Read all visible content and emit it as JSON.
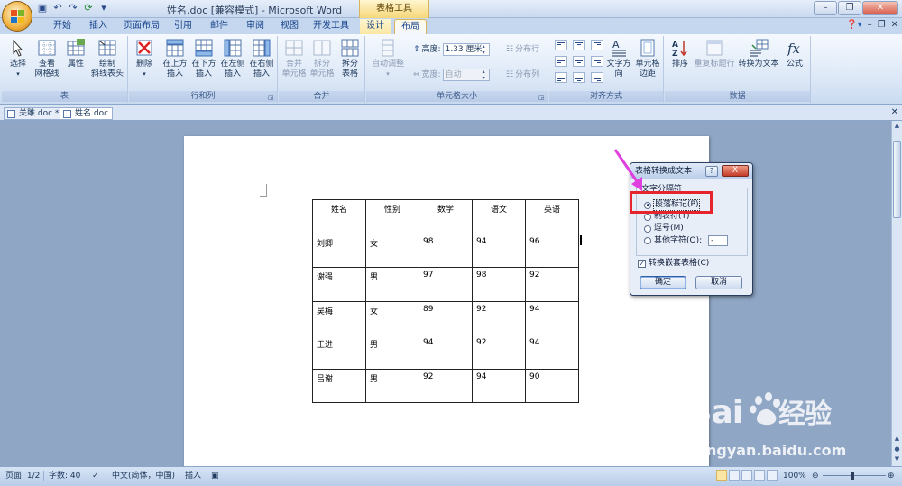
{
  "window": {
    "title": "姓名.doc [兼容模式] - Microsoft Word",
    "context_tab_group": "表格工具"
  },
  "tabs": [
    {
      "label": "开始"
    },
    {
      "label": "插入"
    },
    {
      "label": "页面布局"
    },
    {
      "label": "引用"
    },
    {
      "label": "邮件"
    },
    {
      "label": "审阅"
    },
    {
      "label": "视图"
    },
    {
      "label": "开发工具"
    },
    {
      "label": "设计"
    },
    {
      "label": "布局"
    }
  ],
  "ribbon": {
    "groups": {
      "table": "表",
      "rows_cols": "行和列",
      "merge": "合并",
      "cell_size": "单元格大小",
      "alignment": "对齐方式",
      "data": "数据"
    },
    "buttons": {
      "select": "选择",
      "gridlines_1": "查看",
      "gridlines_2": "网格线",
      "properties": "属性",
      "draw_diag_1": "绘制",
      "draw_diag_2": "斜线表头",
      "delete": "删除",
      "ins_above_1": "在上方",
      "ins_above_2": "插入",
      "ins_below_1": "在下方",
      "ins_below_2": "插入",
      "ins_left_1": "在左侧",
      "ins_left_2": "插入",
      "ins_right_1": "在右侧",
      "ins_right_2": "插入",
      "merge_cells_1": "合并",
      "merge_cells_2": "单元格",
      "split_cells_1": "拆分",
      "split_cells_2": "单元格",
      "split_table_1": "拆分",
      "split_table_2": "表格",
      "autofit": "自动调整",
      "height_label": "高度:",
      "height_value": "1.33 厘米",
      "width_label": "宽度:",
      "width_value": "自动",
      "dist_rows": "分布行",
      "dist_cols": "分布列",
      "text_dir": "文字方向",
      "cell_margin_1": "单元格",
      "cell_margin_2": "边距",
      "sort": "排序",
      "repeat_header": "重复标题行",
      "convert_text": "转换为文本",
      "formula": "公式"
    }
  },
  "doc_tabs": [
    {
      "label": "关雎.doc *"
    },
    {
      "label": "姓名.doc"
    }
  ],
  "table": {
    "headers": [
      "姓名",
      "性别",
      "数学",
      "语文",
      "英语"
    ],
    "rows": [
      [
        "刘卿",
        "女",
        "98",
        "94",
        "96"
      ],
      [
        "谢强",
        "男",
        "97",
        "98",
        "92"
      ],
      [
        "吴梅",
        "女",
        "89",
        "92",
        "94"
      ],
      [
        "王进",
        "男",
        "94",
        "92",
        "94"
      ],
      [
        "吕谢",
        "男",
        "92",
        "94",
        "90"
      ]
    ]
  },
  "dialog": {
    "title": "表格转换成文本",
    "help": "?",
    "close": "X",
    "legend": "文字分隔符",
    "options": [
      {
        "label": "段落标记(P)",
        "checked": true
      },
      {
        "label": "制表符(T)",
        "checked": false
      },
      {
        "label": "逗号(M)",
        "checked": false
      },
      {
        "label": "其他字符(O):",
        "checked": false
      }
    ],
    "other_char_value": "-",
    "nested_label": "转换嵌套表格(C)",
    "nested_checked": true,
    "ok": "确定",
    "cancel": "取消"
  },
  "status": {
    "page": "页面: 1/2",
    "words": "字数: 40",
    "language": "中文(简体，中国)",
    "mode": "插入",
    "zoom": "100%"
  },
  "watermark": {
    "brand": "Bai",
    "brand_suffix": "经验",
    "url": "jingyan.baidu.com"
  },
  "colors": {
    "highlight": "#e5242b",
    "arrow": "#e040e0",
    "ribbon_bg": "#dae6f6",
    "workspace": "#8fa6c5"
  }
}
